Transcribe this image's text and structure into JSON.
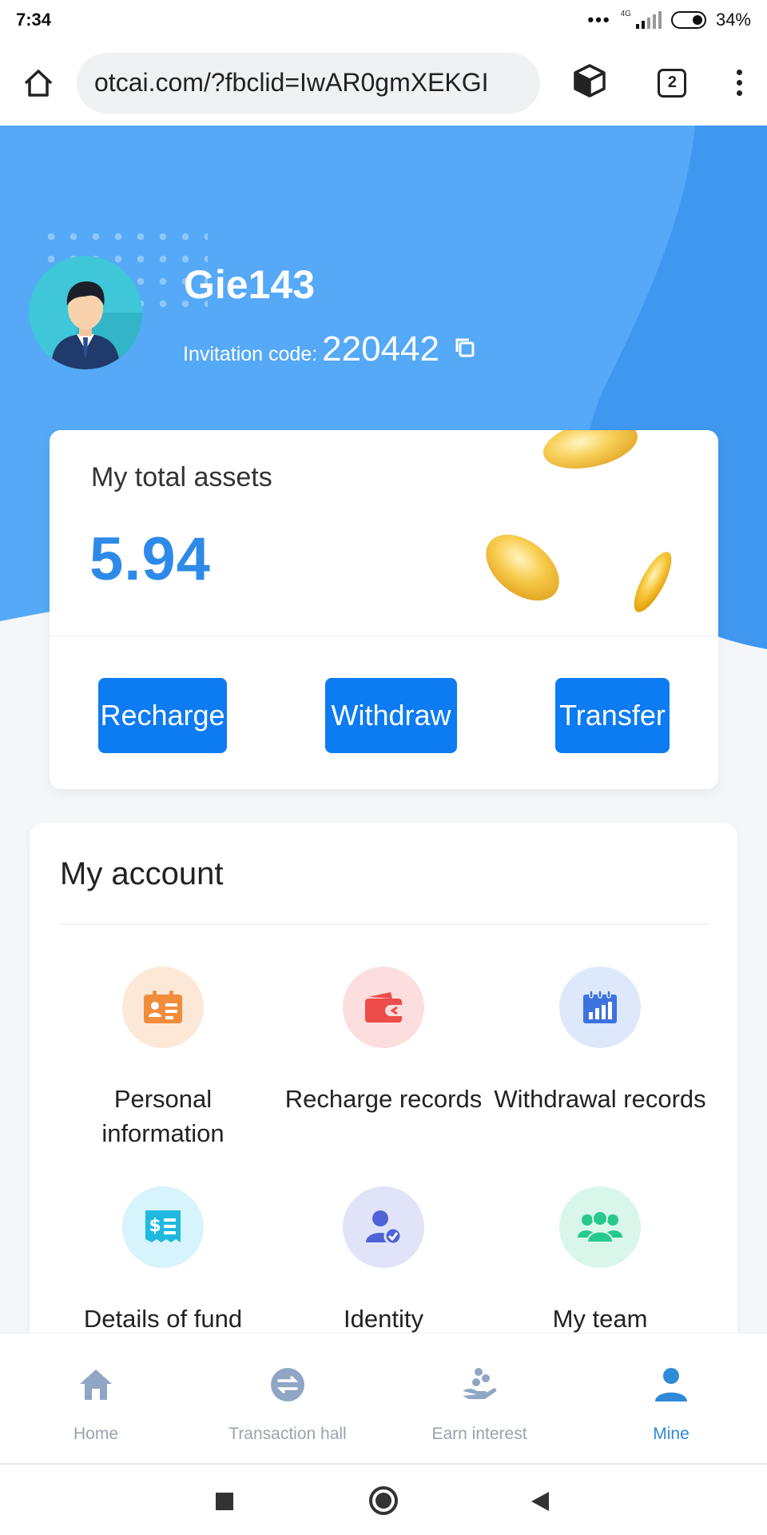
{
  "status_bar": {
    "time": "7:34",
    "dots": "•••",
    "network": "4G",
    "battery": "34%"
  },
  "browser": {
    "url": "otcai.com/?fbclid=IwAR0gmXEKGI",
    "tab_count": "2"
  },
  "profile": {
    "username": "Gie143",
    "invitation_label": "Invitation code:",
    "invitation_code": "220442"
  },
  "assets": {
    "label": "My total assets",
    "value": "5.94",
    "buttons": {
      "recharge": "Recharge",
      "withdraw": "Withdraw",
      "transfer": "Transfer"
    }
  },
  "account": {
    "title": "My account",
    "items": [
      {
        "label": "Personal information",
        "icon": "id-card-icon",
        "color": "#f08c3a",
        "bg": "#fde7d6"
      },
      {
        "label": "Recharge records",
        "icon": "wallet-icon",
        "color": "#ee4b4b",
        "bg": "#fcdede"
      },
      {
        "label": "Withdrawal records",
        "icon": "chart-calendar-icon",
        "color": "#3c73de",
        "bg": "#dde8fb"
      },
      {
        "label": "Details of fund",
        "icon": "receipt-dollar-icon",
        "color": "#1fb9e0",
        "bg": "#d7f3fb"
      },
      {
        "label": "Identity",
        "icon": "user-verified-icon",
        "color": "#4f63d6",
        "bg": "#e1e4f8"
      },
      {
        "label": "My team",
        "icon": "team-icon",
        "color": "#27c98c",
        "bg": "#d8f6ea"
      }
    ]
  },
  "nav": {
    "items": [
      {
        "label": "Home",
        "icon": "home-icon"
      },
      {
        "label": "Transaction hall",
        "icon": "exchange-icon"
      },
      {
        "label": "Earn interest",
        "icon": "hand-coins-icon"
      },
      {
        "label": "Mine",
        "icon": "user-icon"
      }
    ],
    "active": "Mine",
    "active_color": "#2f8bd8",
    "inactive_color": "#9aa3ad"
  },
  "colors": {
    "hero_blue": "#55a9f7",
    "primary_button": "#0d7bf2",
    "asset_value": "#2e8ae8"
  }
}
